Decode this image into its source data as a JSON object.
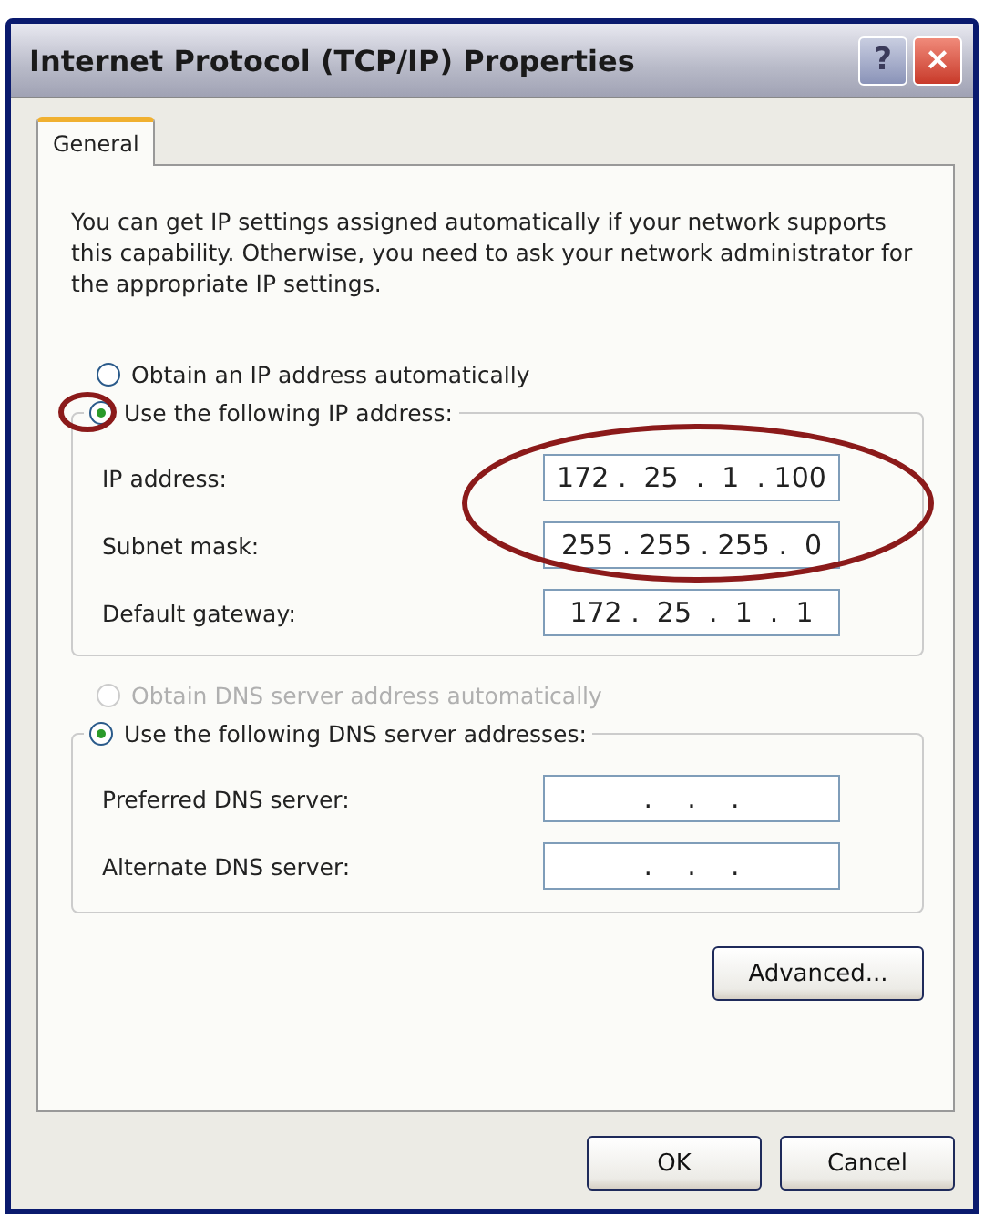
{
  "window": {
    "title": "Internet Protocol (TCP/IP) Properties",
    "help_button": "?",
    "close_button": "×"
  },
  "tabs": [
    {
      "label": "General",
      "selected": true
    }
  ],
  "description": "You can get IP settings assigned automatically if your network supports this capability. Otherwise, you need to ask your network administrator for the appropriate IP settings.",
  "ip_mode": [
    {
      "label": "Obtain an IP address automatically",
      "selected": false,
      "disabled": false
    },
    {
      "label": "Use the following IP address:",
      "selected": true,
      "disabled": false
    }
  ],
  "ip_fields": [
    {
      "label": "IP address:",
      "value": "172 .  25  .  1  . 100"
    },
    {
      "label": "Subnet mask:",
      "value": "255 . 255 . 255 .  0"
    },
    {
      "label": "Default gateway:",
      "value": "172 .  25  .  1  .  1"
    }
  ],
  "dns_mode": [
    {
      "label": "Obtain DNS server address automatically",
      "selected": false,
      "disabled": true
    },
    {
      "label": "Use the following DNS server addresses:",
      "selected": true,
      "disabled": false
    }
  ],
  "dns_fields": [
    {
      "label": "Preferred DNS server:",
      "value": "  .    .    .  "
    },
    {
      "label": "Alternate DNS server:",
      "value": "  .    .    .  "
    }
  ],
  "advanced_button": "Advanced...",
  "buttons": [
    "OK",
    "Cancel"
  ],
  "annotations": [
    {
      "kind": "ellipse"
    },
    {
      "kind": "ellipse"
    }
  ]
}
